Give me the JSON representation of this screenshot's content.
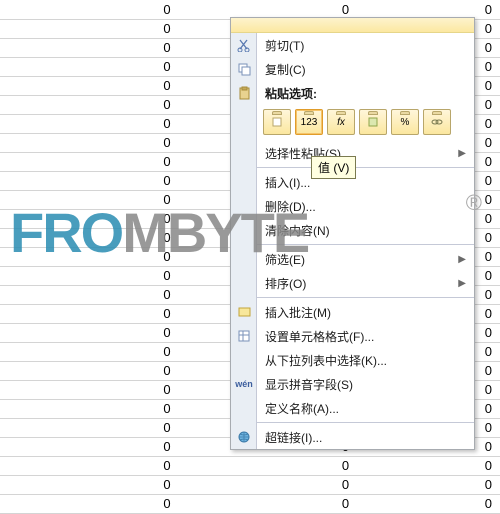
{
  "grid": {
    "rows": 27,
    "cells_per_row": 3,
    "cell_value": "0"
  },
  "menu": {
    "cut": {
      "label": "剪切(T)"
    },
    "copy": {
      "label": "复制(C)"
    },
    "paste_hdr": {
      "label": "粘贴选项:"
    },
    "paste_opts": [
      "",
      "123",
      "fx",
      "",
      "%",
      ""
    ],
    "paste_opts_names": [
      "paste-all",
      "paste-values",
      "paste-formulas",
      "paste-format",
      "paste-percent",
      "paste-link"
    ],
    "paste_special": {
      "label": "选择性粘贴(S)...",
      "has_submenu": true
    },
    "tooltip": "值 (V)",
    "insert": {
      "label": "插入(I)..."
    },
    "delete": {
      "label": "删除(D)..."
    },
    "clear": {
      "label": "清除内容(N)"
    },
    "filter": {
      "label": "筛选(E)",
      "has_submenu": true
    },
    "sort": {
      "label": "排序(O)",
      "has_submenu": true
    },
    "comment": {
      "label": "插入批注(M)"
    },
    "format": {
      "label": "设置单元格格式(F)..."
    },
    "dropdown": {
      "label": "从下拉列表中选择(K)..."
    },
    "pinyin": {
      "label": "显示拼音字段(S)"
    },
    "define": {
      "label": "定义名称(A)..."
    },
    "hyperlink": {
      "label": "超链接(I)..."
    }
  },
  "watermark": {
    "part1": "FRO",
    "part2": "MBYTE",
    "reg": "®"
  }
}
